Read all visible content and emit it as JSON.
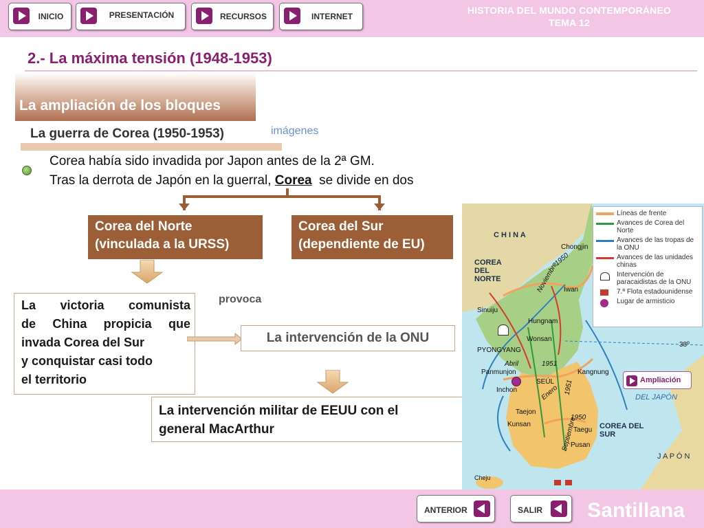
{
  "nav": {
    "buttons": [
      {
        "label": "INICIO"
      },
      {
        "label": "PRESENTACIÓN"
      },
      {
        "label": "RECURSOS"
      },
      {
        "label": "INTERNET"
      }
    ],
    "title_line1": "HISTORIA DEL MUNDO CONTEMPORÁNEO",
    "title_line2": "TEMA 12"
  },
  "section_title": "2.- La máxima tensión (1948-1953)",
  "subsection": "La ampliación de los bloques",
  "topic": {
    "heading": "La guerra de Corea (1950-1953)",
    "link": "imágenes"
  },
  "intro": {
    "line1": "Corea había sido invadida por Japon antes de la 2ª GM.",
    "line2_pre": "Tras la derrota de Japón en la guerral, ",
    "line2_emph": "Corea",
    "line2_post": "  se divide en dos"
  },
  "boxes": {
    "north_line1": "Corea del Norte",
    "north_line2": "(vinculada a la URSS)",
    "south_line1": "Corea del Sur",
    "south_line2": "(dependiente de EU)",
    "china_lines": [
      "La victoria comunista",
      "de China propicia que",
      "invada Corea del Sur",
      "y conquistar casi todo",
      "el territorio"
    ],
    "provoca": "provoca",
    "onu": "La intervención de la ONU",
    "usa_line1": "La intervención militar de EEUU con el",
    "usa_line2": "general MacArthur"
  },
  "map": {
    "labels": {
      "china": "C H I N A",
      "north_korea_1": "COREA",
      "north_korea_2": "DEL",
      "north_korea_3": "NORTE",
      "south_korea_1": "COREA DEL",
      "south_korea_2": "SUR",
      "japan_sea_1": "DEL JAPÓN",
      "japan": "J A P Ó N",
      "parallel": "38º"
    },
    "cities": {
      "chongjin": "Chongjin",
      "iwan": "Iwan",
      "sinuiju": "Sinuiju",
      "hungnam": "Hungnam",
      "wonsan": "Wonsan",
      "pyongyang": "PYONGYANG",
      "panmunjon": "Panmunjon",
      "seul": "SEÚL",
      "kangnung": "Kangnung",
      "inchon": "Inchon",
      "taejon": "Taejon",
      "kunsan": "Kunsan",
      "taegu": "Taegu",
      "pusan": "Pusan",
      "cheju": "Cheju"
    },
    "dates": {
      "noviembre": "Noviembre",
      "y1950a": "1950",
      "abril": "Abril",
      "y1951a": "1951",
      "enero": "Enero",
      "y1951b": "1951",
      "septiembre": "Septiembre",
      "y1950b": "1950"
    },
    "legend": [
      {
        "label": "Líneas de frente",
        "color": "#f2a25a"
      },
      {
        "label": "Avances de Corea del Norte",
        "color": "#2f9a3a"
      },
      {
        "label": "Avances de las tropas de la ONU",
        "color": "#2e7fc2"
      },
      {
        "label": "Avances de las unidades chinas",
        "color": "#d43a2f"
      },
      {
        "label": "Intervención de paracaidistas de la ONU",
        "icon": "parachute-icon"
      },
      {
        "label": "7.ª Flota estadounidense",
        "icon": "ship-icon"
      },
      {
        "label": "Lugar de armisticio",
        "icon": "armistice-icon"
      }
    ],
    "ampliacion": "Ampliación"
  },
  "footer": {
    "prev": "ANTERIOR",
    "exit": "SALIR",
    "brand": "Santillana"
  }
}
